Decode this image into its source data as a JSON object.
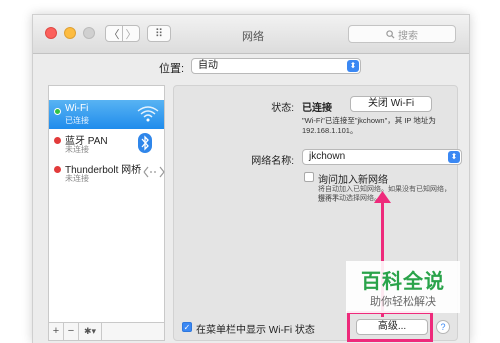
{
  "window": {
    "title": "网络"
  },
  "toolbar": {
    "back": "〈",
    "forward": "〉",
    "grid": "⠿",
    "search_placeholder": "搜索"
  },
  "location": {
    "label": "位置:",
    "value": "自动"
  },
  "services": [
    {
      "name": "Wi-Fi",
      "status": "已连接",
      "dot_color": "#31c244"
    },
    {
      "name": "蓝牙 PAN",
      "status": "未连接",
      "dot_color": "#e23b3b"
    },
    {
      "name": "Thunderbolt 网桥",
      "status": "未连接",
      "dot_color": "#e23b3b"
    }
  ],
  "sidebar_footer": {
    "add": "+",
    "remove": "−",
    "action": "✱▾"
  },
  "detail": {
    "status_label": "状态:",
    "status_value": "已连接",
    "turn_off_button": "关闭 Wi-Fi",
    "status_desc_line1": "\"Wi-Fi\"已连接至\"jkchown\"，其 IP 地址为",
    "status_desc_line2": "192.168.1.101。",
    "network_name_label": "网络名称:",
    "network_name_value": "jkchown",
    "ask_join_label": "询问加入新网络",
    "ask_join_hint_line1": "将自动加入已知网络。如果没有已知网络，您将不",
    "ask_join_hint_line2": "得不手动选择网络。",
    "show_menubar_label": "在菜单栏中显示 Wi-Fi 状态",
    "advanced_button": "高级...",
    "help": "?"
  },
  "watermark": {
    "title": "百科全说",
    "subtitle": "助你轻松解决"
  },
  "colors": {
    "accent": "#3b88f3",
    "selected_row": "#1f8cec",
    "annotation": "#ee2a7b"
  }
}
